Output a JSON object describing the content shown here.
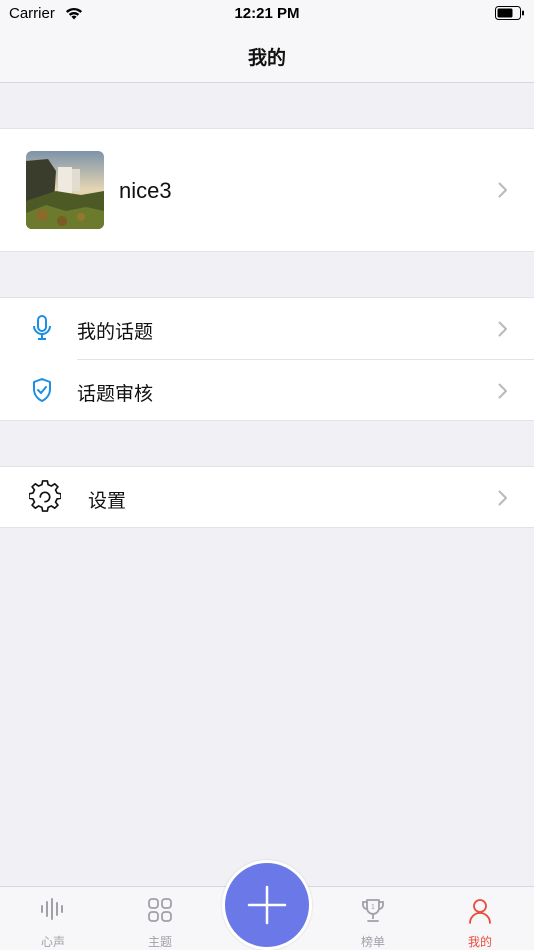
{
  "status_bar": {
    "carrier": "Carrier",
    "time": "12:21 PM"
  },
  "nav": {
    "title": "我的"
  },
  "profile": {
    "username": "nice3"
  },
  "menu": {
    "my_topics": "我的话题",
    "topic_review": "话题审核",
    "settings": "设置"
  },
  "tabs": [
    {
      "label": "心声",
      "icon": "waveform-icon"
    },
    {
      "label": "主题",
      "icon": "grid-icon"
    },
    {
      "label": "榜单",
      "icon": "trophy-icon"
    },
    {
      "label": "我的",
      "icon": "person-icon",
      "active": true
    }
  ],
  "colors": {
    "accent_blue": "#1a8fe3",
    "fab": "#6b78e8",
    "active_tab": "#ec4c3c",
    "inactive_tab": "#a0a0a8"
  }
}
